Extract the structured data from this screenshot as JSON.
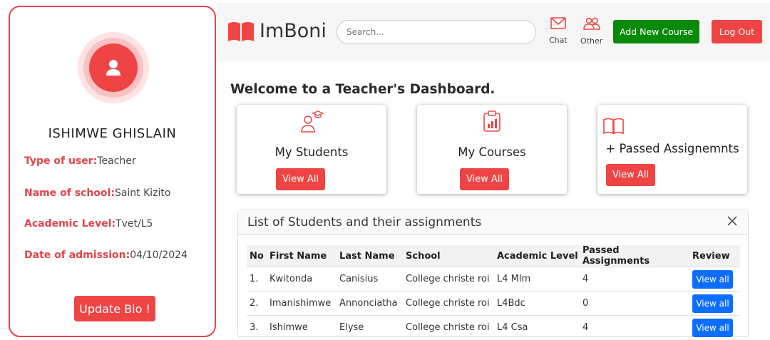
{
  "profile": {
    "name": "ISHIMWE GHISLAIN",
    "fields": [
      {
        "key": "Type of user:",
        "value": "Teacher"
      },
      {
        "key": "Name of school:",
        "value": "Saint Kizito"
      },
      {
        "key": "Academic Level:",
        "value": "Tvet/L5"
      },
      {
        "key": "Date of admission:",
        "value": "04/10/2024"
      }
    ],
    "update_button": "Update Bio !"
  },
  "header": {
    "logo_text": "ImBoni",
    "search_placeholder": "Search...",
    "chat_label": "Chat",
    "other_label": "Other",
    "add_course_label": "Add New Course",
    "logout_label": "Log Out"
  },
  "main": {
    "welcome": "Welcome to a Teacher's Dashboard.",
    "cards": [
      {
        "title": "My Students",
        "button": "View All"
      },
      {
        "title": "My Courses",
        "button": "View All"
      },
      {
        "title": "+ Passed Assignemnts",
        "button": "View All"
      }
    ]
  },
  "table": {
    "title": "List of Students and their assignments",
    "columns": [
      "No",
      "First Name",
      "Last Name",
      "School",
      "Academic Level",
      "Passed Assignments",
      "Review"
    ],
    "rows": [
      {
        "no": "1.",
        "first": "Kwitonda",
        "last": "Canisius",
        "school": "College christe roi",
        "level": "L4 Mlm",
        "passed": "4",
        "review": "View all"
      },
      {
        "no": "2.",
        "first": "Imanishimwe",
        "last": "Annonciatha",
        "school": "College christe roi",
        "level": "L4Bdc",
        "passed": "0",
        "review": "View all"
      },
      {
        "no": "3.",
        "first": "Ishimwe",
        "last": "Elyse",
        "school": "College christe roi",
        "level": "L4 Csa",
        "passed": "4",
        "review": "View all"
      }
    ]
  },
  "colors": {
    "accent": "#ef4444",
    "green": "#0a8a0a",
    "blue": "#0d6efd"
  }
}
